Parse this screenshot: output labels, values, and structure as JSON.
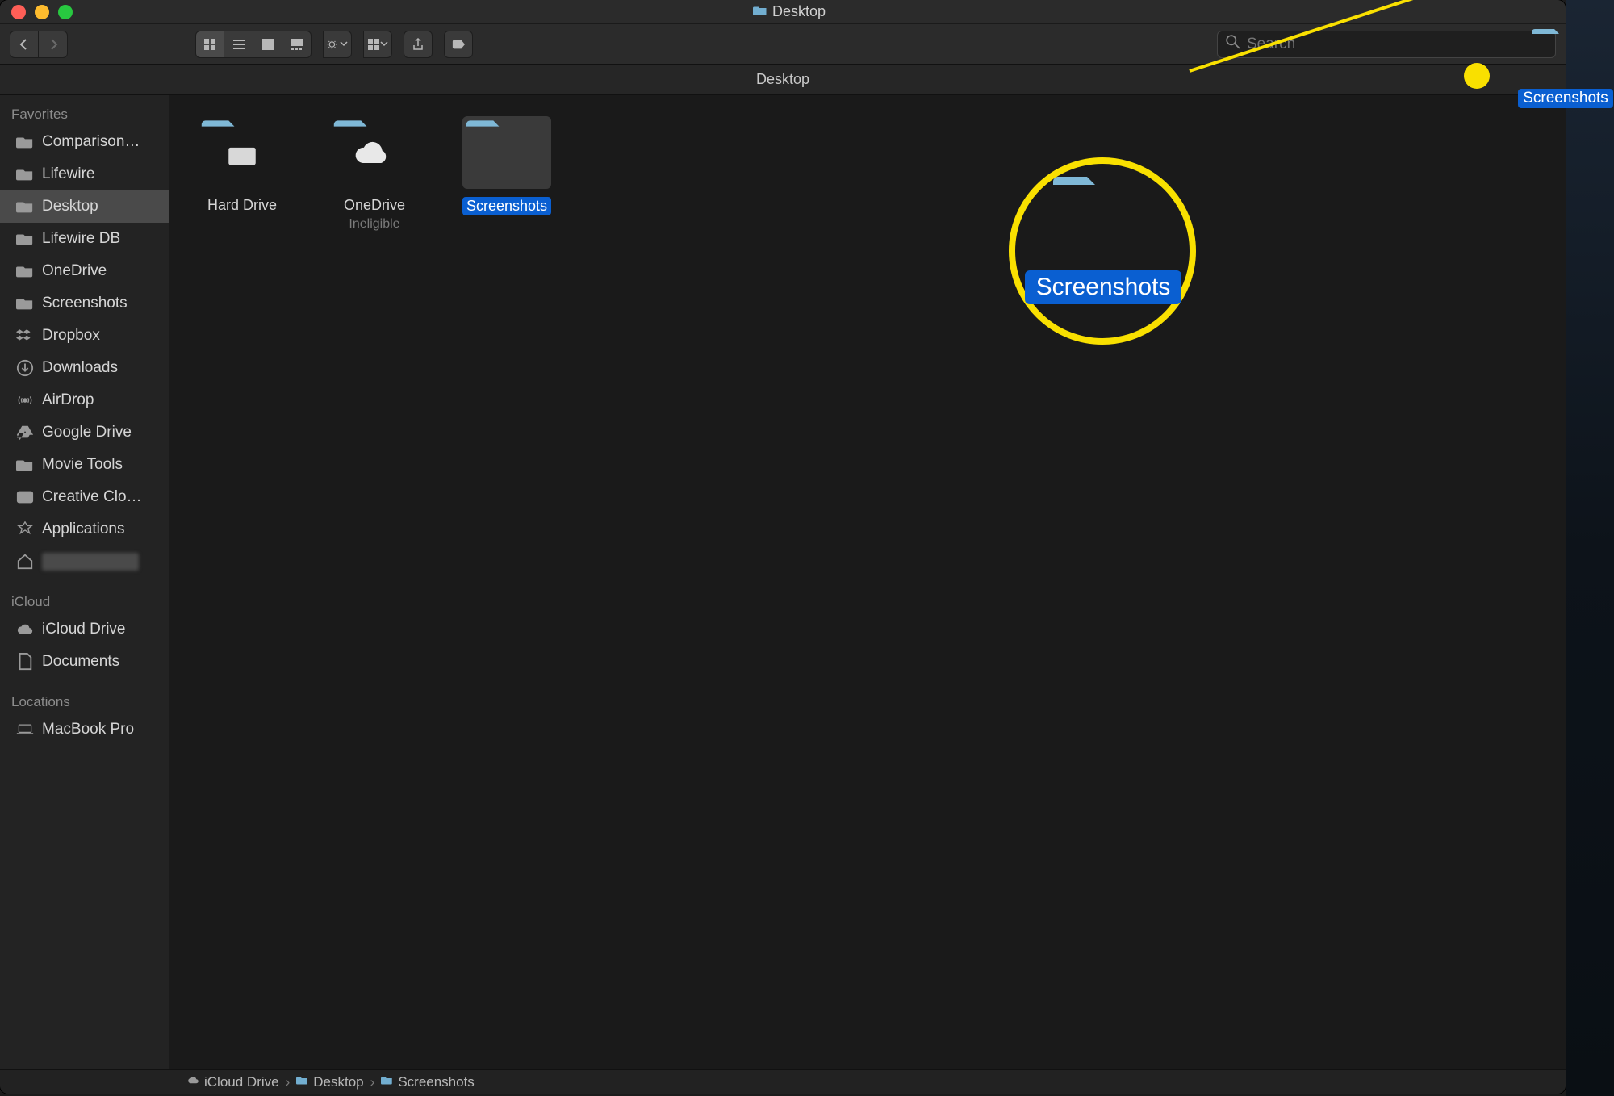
{
  "titlebar": {
    "title": "Desktop"
  },
  "toolbar": {
    "search_placeholder": "Search"
  },
  "locbar": {
    "title": "Desktop"
  },
  "sidebar": {
    "section_favorites": "Favorites",
    "section_icloud": "iCloud",
    "section_locations": "Locations",
    "favorites": [
      {
        "label": "Comparison…",
        "icon": "folder"
      },
      {
        "label": "Lifewire",
        "icon": "folder"
      },
      {
        "label": "Desktop",
        "icon": "folder",
        "active": true
      },
      {
        "label": "Lifewire DB",
        "icon": "folder"
      },
      {
        "label": "OneDrive",
        "icon": "folder"
      },
      {
        "label": "Screenshots",
        "icon": "folder"
      },
      {
        "label": "Dropbox",
        "icon": "dropbox"
      },
      {
        "label": "Downloads",
        "icon": "downloads"
      },
      {
        "label": "AirDrop",
        "icon": "airdrop"
      },
      {
        "label": "Google Drive",
        "icon": "gdrive"
      },
      {
        "label": "Movie Tools",
        "icon": "folder"
      },
      {
        "label": "Creative Clo…",
        "icon": "cc"
      },
      {
        "label": "Applications",
        "icon": "apps"
      },
      {
        "label": "",
        "icon": "home",
        "redacted": true
      }
    ],
    "icloud": [
      {
        "label": "iCloud Drive",
        "icon": "cloud"
      },
      {
        "label": "Documents",
        "icon": "doc"
      }
    ],
    "locations": [
      {
        "label": "MacBook Pro",
        "icon": "laptop"
      }
    ]
  },
  "content": {
    "items": [
      {
        "label": "Hard Drive",
        "type": "drive"
      },
      {
        "label": "OneDrive",
        "sub": "Ineligible",
        "type": "cloudfolder"
      },
      {
        "label": "Screenshots",
        "type": "folder",
        "selected": true
      }
    ]
  },
  "pathbar": {
    "crumbs": [
      {
        "label": "iCloud Drive",
        "icon": "cloud"
      },
      {
        "label": "Desktop",
        "icon": "folder"
      },
      {
        "label": "Screenshots",
        "icon": "folder"
      }
    ]
  },
  "desktop_folder": {
    "label": "Screenshots"
  },
  "annotation": {
    "label": "Screenshots"
  }
}
